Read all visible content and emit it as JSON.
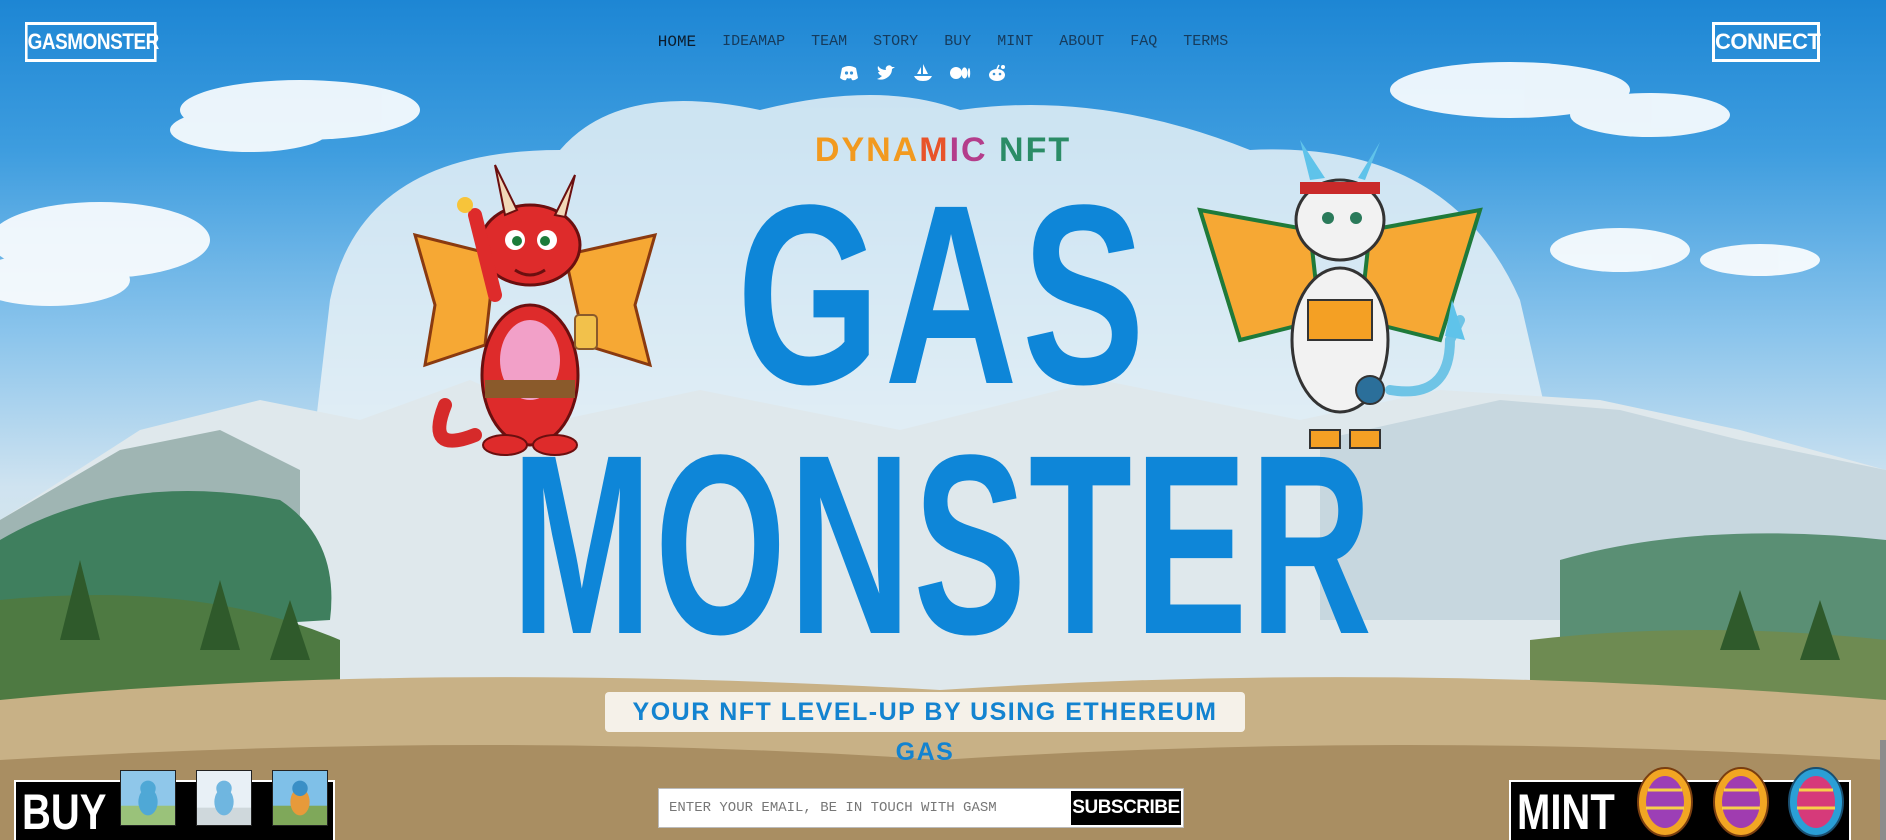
{
  "header": {
    "logo": "GASMONSTER",
    "connect_label": "CONNECT",
    "nav": [
      "HOME",
      "IDEAMAP",
      "TEAM",
      "STORY",
      "BUY",
      "MINT",
      "ABOUT",
      "FAQ",
      "TERMS"
    ],
    "active_nav": "HOME",
    "socials": [
      "discord-icon",
      "twitter-icon",
      "opensea-icon",
      "medium-icon",
      "reddit-icon"
    ]
  },
  "hero": {
    "eyebrow": [
      "DYNA",
      "M",
      "IC",
      " NFT"
    ],
    "title_line1": "GAS",
    "title_line2": "MONSTER",
    "tagline": "YOUR NFT LEVEL-UP BY USING ETHEREUM GAS"
  },
  "buy": {
    "label": "BUY",
    "thumbnails": [
      "nft-thumbnail-1",
      "nft-thumbnail-2",
      "nft-thumbnail-3"
    ]
  },
  "mint": {
    "label": "MINT",
    "eggs": [
      "egg-1",
      "egg-2",
      "egg-3"
    ]
  },
  "subscribe": {
    "placeholder": "ENTER YOUR EMAIL, BE IN TOUCH WITH GASM",
    "button": "SUBSCRIBE"
  },
  "colors": {
    "title_blue": "#0e86d8",
    "sky": "#1d86d4",
    "black": "#000000",
    "white": "#ffffff"
  }
}
